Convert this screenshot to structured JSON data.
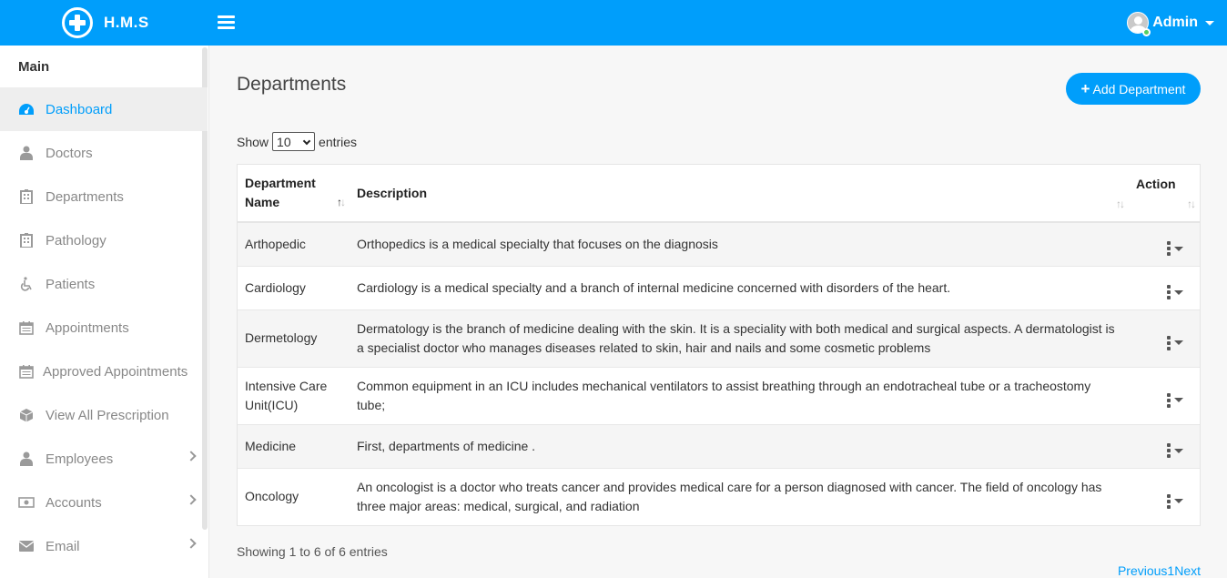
{
  "header": {
    "brand": "H.M.S",
    "user_name": "Admin",
    "accent_color": "#009efb"
  },
  "sidebar": {
    "title": "Main",
    "items": [
      {
        "label": "Dashboard",
        "icon": "dashboard-icon"
      },
      {
        "label": "Doctors",
        "icon": "user-md-icon"
      },
      {
        "label": "Departments",
        "icon": "hospital-icon"
      },
      {
        "label": "Pathology",
        "icon": "hospital-icon"
      },
      {
        "label": "Patients",
        "icon": "wheelchair-icon"
      },
      {
        "label": "Appointments",
        "icon": "calendar-icon"
      },
      {
        "label": "Approved Appointments",
        "icon": "calendar-icon"
      },
      {
        "label": "View All Prescription",
        "icon": "cube-icon"
      },
      {
        "label": "Employees",
        "icon": "user-icon"
      },
      {
        "label": "Accounts",
        "icon": "money-icon"
      },
      {
        "label": "Email",
        "icon": "envelope-icon"
      }
    ]
  },
  "main": {
    "title": "Departments",
    "add_button": "Add Department",
    "show_label": "Show",
    "entries_label": "entries",
    "page_size": "10",
    "columns": [
      "Department Name",
      "Description",
      "Action"
    ],
    "rows": [
      {
        "name": "Arthopedic",
        "description": "Orthopedics is a medical specialty that focuses on the diagnosis"
      },
      {
        "name": "Cardiology",
        "description": "Cardiology is a medical specialty and a branch of internal medicine concerned with disorders of the heart."
      },
      {
        "name": "Dermetology",
        "description": "Dermatology is the branch of medicine dealing with the skin. It is a speciality with both medical and surgical aspects. A dermatologist is a specialist doctor who manages diseases related to skin, hair and nails and some cosmetic problems"
      },
      {
        "name": "Intensive Care Unit(ICU)",
        "description": "Common equipment in an ICU includes mechanical ventilators to assist breathing through an endotracheal tube or a tracheostomy tube;"
      },
      {
        "name": "Medicine",
        "description": "First, departments of medicine ."
      },
      {
        "name": "Oncology",
        "description": "An oncologist is a doctor who treats cancer and provides medical care for a person diagnosed with cancer. The field of oncology has three major areas: medical, surgical, and radiation"
      }
    ],
    "info": "Showing 1 to 6 of 6 entries",
    "pager": {
      "previous": "Previous",
      "page": "1",
      "next": "Next"
    }
  }
}
